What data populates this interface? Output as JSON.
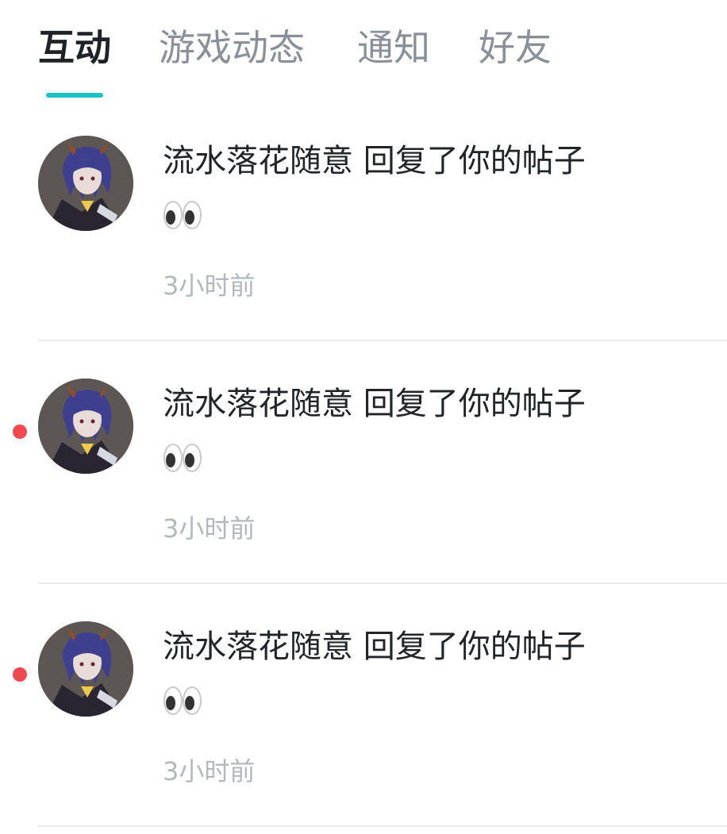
{
  "tabs": [
    {
      "label": "互动",
      "active": true
    },
    {
      "label": "游戏动态",
      "active": false
    },
    {
      "label": "通知",
      "active": false
    },
    {
      "label": "好友",
      "active": false
    }
  ],
  "colors": {
    "accent": "#1bc3c9",
    "unread_dot": "#f0494e",
    "text_primary": "#222428",
    "text_secondary": "#b4b7bb",
    "tab_inactive": "#8a9097"
  },
  "notifications": [
    {
      "title": "流水落花随意 回复了你的帖子",
      "content": "👀",
      "content_icon": "eyes-emoji",
      "time": "3小时前",
      "unread": false,
      "avatar_icon": "anime-character-avatar"
    },
    {
      "title": "流水落花随意 回复了你的帖子",
      "content": "👀",
      "content_icon": "eyes-emoji",
      "time": "3小时前",
      "unread": true,
      "avatar_icon": "anime-character-avatar"
    },
    {
      "title": "流水落花随意 回复了你的帖子",
      "content": "👀",
      "content_icon": "eyes-emoji",
      "time": "3小时前",
      "unread": true,
      "avatar_icon": "anime-character-avatar"
    }
  ]
}
